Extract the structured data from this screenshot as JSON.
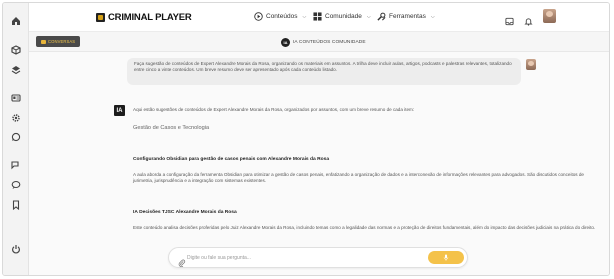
{
  "brand": {
    "name": "CRIMINAL PLAYER"
  },
  "nav": [
    {
      "label": "Conteúdos",
      "icon": "play-icon"
    },
    {
      "label": "Comunidade",
      "icon": "grid-icon"
    },
    {
      "label": "Ferramentas",
      "icon": "tools-icon"
    }
  ],
  "subbar": {
    "conversations_label": "CONVERSAS",
    "badge": "IA",
    "title": "IA CONTEÚDOS COMUNIDADE"
  },
  "chat": {
    "user_message": "Faça sugestão de conteúdos de Expert Alexandre Morais da Rosa, organizando os materiais em assuntos. A trilha deve incluir aulas, artigos, podcasts e palestras relevantes, totalizando entre cinco a vinte conteúdos. Um breve resumo deve ser apresentado após cada conteúdo listado.",
    "ai_logo": "IA",
    "ai_intro": "Aqui estão sugestões de conteúdos de Expert Alexandre Morais da Rosa, organizados por assuntos, com um breve resumo de cada item:",
    "topic": "Gestão de Casos e Tecnologia",
    "items": [
      {
        "title": "Configurando Obsidian para gestão de casos penais com Alexandre Morais da Rosa",
        "summary": "A aula aborda a configuração da ferramenta Obsidian para otimizar a gestão de casos penais, enfatizando a organização de dados e a interconexão de informações relevantes para advogados. São discutidos conceitos de jurimetria, jurisprudência e a integração com sistemas existentes."
      },
      {
        "title": "IA Decisões TJSC Alexandre Morais da Rosa",
        "summary": "Este conteúdo analisa decisões proferidas pelo Juiz Alexandre Morais da Rosa, incluindo temas como a legalidade das normas e a proteção de direitos fundamentais, além do impacto das decisões judiciais na prática do direito."
      }
    ]
  },
  "input": {
    "placeholder": "Digite ou fale sua pergunta..."
  },
  "colors": {
    "accent": "#f4c24a",
    "dark": "#1c1c1c",
    "sidebar": "#f3f3f3"
  }
}
